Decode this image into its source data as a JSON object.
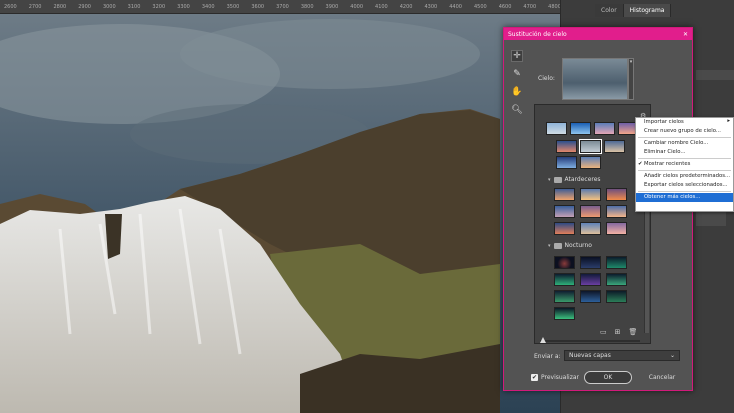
{
  "ruler_ticks": [
    "2600",
    "2700",
    "2800",
    "2900",
    "3000",
    "3100",
    "3200",
    "3300",
    "3400",
    "3500",
    "3600",
    "3700",
    "3800",
    "3900",
    "4000",
    "4100",
    "4200",
    "4300",
    "4400",
    "4500",
    "4600",
    "4700",
    "4800",
    "4900",
    "5000",
    "5100",
    "5200",
    "5300",
    "5400",
    "5500",
    "5600"
  ],
  "panel_tabs": {
    "color": "Color",
    "histogram": "Histograma"
  },
  "dialog": {
    "title": "Sustitución de cielo",
    "close": "✕",
    "sky_label": "Cielo:",
    "groups": {
      "sunsets": "Atardeceres",
      "night": "Nocturno"
    },
    "output_label": "Enviar a:",
    "output_value": "Nuevas capas",
    "preview_label": "Previsualizar",
    "ok": "OK",
    "cancel": "Cancelar"
  },
  "context_menu": {
    "items": [
      {
        "label": "Importar cielos",
        "submenu": true
      },
      {
        "label": "Crear nuevo grupo de cielo..."
      },
      {
        "label": "Cambiar nombre Cielo..."
      },
      {
        "label": "Eliminar Cielo..."
      },
      {
        "label": "Mostrar recientes",
        "checked": true
      },
      {
        "label": "Añadir cielos predeterminados..."
      },
      {
        "label": "Exportar cielos seleccionados..."
      },
      {
        "label": "Obtener más cielos...",
        "highlighted": true
      }
    ]
  },
  "colors": {
    "dialog_border": "#e11e8c",
    "menu_highlight": "#1f6ed4"
  }
}
